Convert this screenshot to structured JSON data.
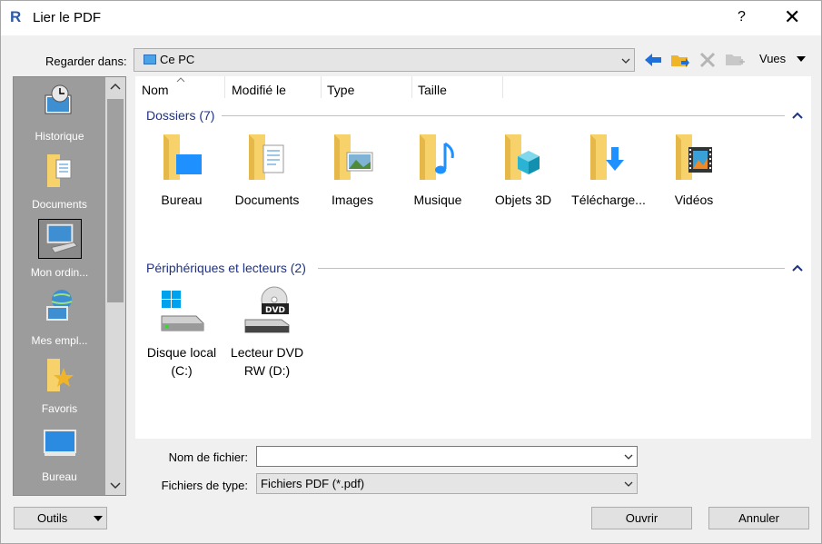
{
  "window": {
    "title": "Lier le PDF",
    "help": "?",
    "close": "✕"
  },
  "lookin": {
    "label": "Regarder dans:",
    "value": "Ce PC",
    "vues_label": "Vues"
  },
  "places": [
    {
      "label": "Historique"
    },
    {
      "label": "Documents"
    },
    {
      "label": "Mon ordin..."
    },
    {
      "label": "Mes empl..."
    },
    {
      "label": "Favoris"
    },
    {
      "label": "Bureau"
    }
  ],
  "columns": [
    "Nom",
    "Modifié le",
    "Type",
    "Taille"
  ],
  "groups": {
    "folders": {
      "title": "Dossiers (7)",
      "items": [
        "Bureau",
        "Documents",
        "Images",
        "Musique",
        "Objets 3D",
        "Télécharge...",
        "Vidéos"
      ]
    },
    "drives": {
      "title": "Périphériques et lecteurs (2)",
      "items": [
        {
          "line1": "Disque local",
          "line2": "(C:)"
        },
        {
          "line1": "Lecteur DVD",
          "line2": "RW (D:)"
        }
      ]
    }
  },
  "fields": {
    "filename_label": "Nom de fichier:",
    "filename_value": "",
    "filetype_label": "Fichiers de type:",
    "filetype_value": "Fichiers PDF  (*.pdf)"
  },
  "buttons": {
    "tools": "Outils",
    "open": "Ouvrir",
    "cancel": "Annuler"
  },
  "colors": {
    "group_title": "#1e3287",
    "accent": "#1e6fd9",
    "folder": "#f7d26b"
  },
  "icons": {
    "back": "arrow-left-icon",
    "up": "folder-up-icon",
    "delete": "delete-icon",
    "new-folder": "new-folder-icon"
  }
}
